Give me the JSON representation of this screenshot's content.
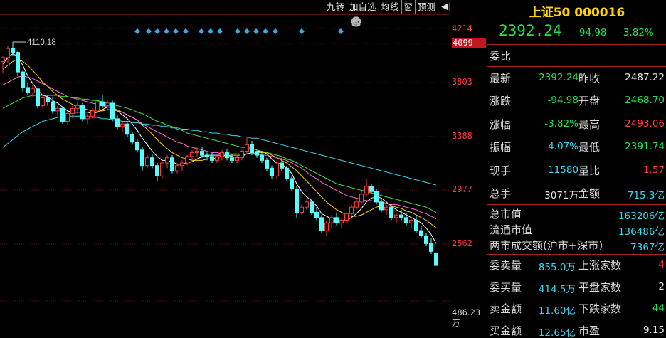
{
  "toolbar": {
    "items": [
      "九转",
      "加自选",
      "均线",
      "窗",
      "预测"
    ],
    "arrow": "◀|"
  },
  "tools": [
    "eye-icon",
    "hand-icon",
    "undo-icon",
    "scissors-icon",
    "lock-icon",
    "zoom-in-icon",
    "zoom-out-icon"
  ],
  "chart_annotation": "4110.18",
  "price_axis": {
    "ticks": [
      "4214",
      "4099",
      "3803",
      "3388",
      "2977",
      "2562"
    ],
    "volume_label": "486.23万"
  },
  "quote": {
    "title": "上证50 000016",
    "price": "2392.24",
    "change": "-94.98",
    "change_pct": "-3.82%"
  },
  "weibi": {
    "label": "委比",
    "value": "–"
  },
  "grid_rows": [
    {
      "l1": "最新",
      "v1": "2392.24",
      "c1": "g",
      "l2": "昨收",
      "v2": "2487.22",
      "c2": "w"
    },
    {
      "l1": "涨跌",
      "v1": "-94.98",
      "c1": "g",
      "l2": "开盘",
      "v2": "2468.70",
      "c2": "g"
    },
    {
      "l1": "涨幅",
      "v1": "-3.82%",
      "c1": "g",
      "l2": "最高",
      "v2": "2493.06",
      "c2": "r"
    },
    {
      "l1": "振幅",
      "v1": "4.07%",
      "c1": "c",
      "l2": "最低",
      "v2": "2391.74",
      "c2": "g"
    },
    {
      "l1": "现手",
      "v1": "11580",
      "c1": "c",
      "l2": "量比",
      "v2": "1.57",
      "c2": "r"
    },
    {
      "l1": "总手",
      "v1": "3071万",
      "c1": "w",
      "l2": "金额",
      "v2": "715.3亿",
      "c2": "c"
    }
  ],
  "market": [
    {
      "label": "总市值",
      "value": "163206亿"
    },
    {
      "label": "流通市值",
      "value": "136486亿"
    },
    {
      "label": "两市成交额(沪市+深市)",
      "value": "7367亿"
    }
  ],
  "stats": [
    {
      "l1": "委卖量",
      "v1": "855.0万",
      "l2": "上涨家数",
      "v2": "4",
      "c2": "r"
    },
    {
      "l1": "委买量",
      "v1": "414.5万",
      "l2": "平盘家数",
      "v2": "2",
      "c2": "w"
    },
    {
      "l1": "卖金额",
      "v1": "11.60亿",
      "l2": "下跌家数",
      "v2": "44",
      "c2": "g"
    },
    {
      "l1": "买金额",
      "v1": "12.65亿",
      "l2": "市盈",
      "v2": "9.15",
      "c2": "w"
    }
  ],
  "chart_data": {
    "type": "candlestick",
    "y_axis_ticks": [
      4214,
      4099,
      3803,
      3388,
      2977,
      2562
    ],
    "peak_label": "4110.18",
    "last_close": 2392.24,
    "ohlc": [
      [
        3960,
        4000,
        3870,
        3990
      ],
      [
        3990,
        4080,
        3950,
        4060
      ],
      [
        4060,
        4110,
        4000,
        4030
      ],
      [
        4030,
        4040,
        3850,
        3880
      ],
      [
        3880,
        3890,
        3730,
        3760
      ],
      [
        3760,
        3800,
        3700,
        3720
      ],
      [
        3720,
        3780,
        3690,
        3750
      ],
      [
        3750,
        3760,
        3600,
        3620
      ],
      [
        3620,
        3700,
        3600,
        3680
      ],
      [
        3680,
        3700,
        3620,
        3650
      ],
      [
        3650,
        3690,
        3560,
        3580
      ],
      [
        3580,
        3620,
        3540,
        3600
      ],
      [
        3600,
        3610,
        3480,
        3500
      ],
      [
        3500,
        3580,
        3470,
        3560
      ],
      [
        3560,
        3620,
        3520,
        3600
      ],
      [
        3600,
        3650,
        3560,
        3620
      ],
      [
        3620,
        3640,
        3500,
        3520
      ],
      [
        3520,
        3560,
        3480,
        3540
      ],
      [
        3540,
        3600,
        3520,
        3580
      ],
      [
        3580,
        3660,
        3560,
        3650
      ],
      [
        3650,
        3700,
        3600,
        3620
      ],
      [
        3620,
        3660,
        3580,
        3640
      ],
      [
        3640,
        3660,
        3500,
        3520
      ],
      [
        3520,
        3550,
        3440,
        3460
      ],
      [
        3460,
        3500,
        3420,
        3480
      ],
      [
        3480,
        3490,
        3380,
        3400
      ],
      [
        3400,
        3420,
        3320,
        3340
      ],
      [
        3340,
        3360,
        3260,
        3280
      ],
      [
        3280,
        3300,
        3120,
        3160
      ],
      [
        3160,
        3240,
        3140,
        3220
      ],
      [
        3220,
        3250,
        3140,
        3160
      ],
      [
        3160,
        3180,
        3040,
        3080
      ],
      [
        3080,
        3200,
        3060,
        3180
      ],
      [
        3180,
        3240,
        3140,
        3220
      ],
      [
        3220,
        3240,
        3100,
        3120
      ],
      [
        3120,
        3180,
        3100,
        3160
      ],
      [
        3160,
        3200,
        3120,
        3180
      ],
      [
        3180,
        3240,
        3160,
        3230
      ],
      [
        3230,
        3280,
        3200,
        3260
      ],
      [
        3260,
        3300,
        3230,
        3270
      ],
      [
        3270,
        3300,
        3220,
        3240
      ],
      [
        3240,
        3260,
        3200,
        3230
      ],
      [
        3230,
        3260,
        3180,
        3200
      ],
      [
        3200,
        3240,
        3180,
        3230
      ],
      [
        3230,
        3280,
        3200,
        3260
      ],
      [
        3260,
        3290,
        3200,
        3220
      ],
      [
        3220,
        3250,
        3180,
        3200
      ],
      [
        3200,
        3240,
        3180,
        3220
      ],
      [
        3220,
        3280,
        3200,
        3270
      ],
      [
        3270,
        3380,
        3250,
        3320
      ],
      [
        3320,
        3350,
        3240,
        3260
      ],
      [
        3260,
        3280,
        3220,
        3240
      ],
      [
        3240,
        3260,
        3180,
        3200
      ],
      [
        3200,
        3220,
        3120,
        3140
      ],
      [
        3140,
        3160,
        3060,
        3080
      ],
      [
        3080,
        3200,
        3060,
        3180
      ],
      [
        3180,
        3220,
        3120,
        3140
      ],
      [
        3140,
        3160,
        3040,
        3060
      ],
      [
        3060,
        3080,
        2960,
        2980
      ],
      [
        2980,
        3000,
        2760,
        2800
      ],
      [
        2800,
        2860,
        2780,
        2840
      ],
      [
        2840,
        2900,
        2820,
        2880
      ],
      [
        2880,
        2900,
        2780,
        2800
      ],
      [
        2800,
        2840,
        2740,
        2760
      ],
      [
        2760,
        2780,
        2640,
        2660
      ],
      [
        2660,
        2740,
        2620,
        2720
      ],
      [
        2720,
        2780,
        2680,
        2760
      ],
      [
        2760,
        2800,
        2700,
        2720
      ],
      [
        2720,
        2760,
        2680,
        2740
      ],
      [
        2740,
        2800,
        2720,
        2790
      ],
      [
        2790,
        2860,
        2760,
        2840
      ],
      [
        2840,
        2900,
        2820,
        2880
      ],
      [
        2880,
        2960,
        2860,
        2940
      ],
      [
        2940,
        3060,
        2920,
        3000
      ],
      [
        3000,
        3020,
        2940,
        2960
      ],
      [
        2960,
        2980,
        2860,
        2880
      ],
      [
        2880,
        2900,
        2800,
        2820
      ],
      [
        2820,
        2860,
        2780,
        2840
      ],
      [
        2840,
        2860,
        2740,
        2760
      ],
      [
        2760,
        2800,
        2720,
        2780
      ],
      [
        2780,
        2820,
        2740,
        2760
      ],
      [
        2760,
        2800,
        2700,
        2720
      ],
      [
        2720,
        2760,
        2680,
        2740
      ],
      [
        2740,
        2780,
        2640,
        2660
      ],
      [
        2660,
        2700,
        2600,
        2620
      ],
      [
        2620,
        2640,
        2540,
        2560
      ],
      [
        2560,
        2600,
        2480,
        2500
      ],
      [
        2487,
        2493,
        2391,
        2392
      ]
    ],
    "ma": [
      {
        "color": "#ffffff",
        "values": [
          3940,
          3990,
          4020,
          4000,
          3930,
          3850,
          3790,
          3740,
          3700,
          3690,
          3660,
          3640,
          3610,
          3580,
          3570,
          3570,
          3570,
          3570,
          3560,
          3570,
          3590,
          3610,
          3610,
          3580,
          3550,
          3520,
          3480,
          3430,
          3370,
          3320,
          3270,
          3230,
          3200,
          3200,
          3190,
          3170,
          3170,
          3180,
          3190,
          3210,
          3230,
          3240,
          3240,
          3240,
          3240,
          3240,
          3230,
          3220,
          3230,
          3250,
          3260,
          3270,
          3270,
          3250,
          3210,
          3180,
          3170,
          3140,
          3100,
          3020,
          2960,
          2920,
          2890,
          2850,
          2790,
          2770,
          2750,
          2740,
          2740,
          2740,
          2760,
          2790,
          2830,
          2880,
          2910,
          2920,
          2910,
          2880,
          2850,
          2820,
          2800,
          2780,
          2760,
          2740,
          2720,
          2680,
          2630,
          2560
        ]
      },
      {
        "color": "#ffd200",
        "values": [
          3900,
          3930,
          3960,
          3980,
          3960,
          3930,
          3890,
          3850,
          3800,
          3770,
          3730,
          3700,
          3670,
          3650,
          3630,
          3610,
          3600,
          3590,
          3580,
          3580,
          3580,
          3590,
          3590,
          3580,
          3570,
          3550,
          3530,
          3510,
          3470,
          3440,
          3400,
          3360,
          3320,
          3290,
          3260,
          3240,
          3220,
          3210,
          3200,
          3200,
          3200,
          3210,
          3210,
          3220,
          3230,
          3240,
          3240,
          3240,
          3240,
          3250,
          3250,
          3260,
          3260,
          3260,
          3240,
          3220,
          3200,
          3180,
          3150,
          3120,
          3080,
          3040,
          3000,
          2960,
          2920,
          2880,
          2850,
          2820,
          2800,
          2780,
          2770,
          2770,
          2780,
          2800,
          2820,
          2840,
          2850,
          2850,
          2850,
          2840,
          2830,
          2810,
          2800,
          2780,
          2760,
          2740,
          2710,
          2680
        ]
      },
      {
        "color": "#ff6ad5",
        "values": [
          3780,
          3800,
          3820,
          3840,
          3850,
          3840,
          3830,
          3810,
          3790,
          3770,
          3750,
          3730,
          3710,
          3690,
          3680,
          3670,
          3660,
          3650,
          3640,
          3630,
          3620,
          3610,
          3600,
          3590,
          3570,
          3550,
          3530,
          3510,
          3480,
          3460,
          3440,
          3420,
          3400,
          3380,
          3360,
          3340,
          3330,
          3310,
          3300,
          3290,
          3280,
          3270,
          3260,
          3260,
          3250,
          3250,
          3250,
          3250,
          3250,
          3250,
          3250,
          3250,
          3240,
          3240,
          3230,
          3220,
          3210,
          3200,
          3180,
          3160,
          3140,
          3110,
          3080,
          3060,
          3030,
          3010,
          2990,
          2970,
          2950,
          2930,
          2920,
          2910,
          2900,
          2890,
          2890,
          2880,
          2880,
          2870,
          2860,
          2860,
          2850,
          2840,
          2830,
          2820,
          2800,
          2790,
          2770,
          2750
        ]
      },
      {
        "color": "#44e04a",
        "values": [
          3600,
          3620,
          3640,
          3660,
          3680,
          3690,
          3700,
          3700,
          3700,
          3700,
          3700,
          3700,
          3690,
          3690,
          3680,
          3680,
          3670,
          3670,
          3660,
          3660,
          3650,
          3640,
          3630,
          3620,
          3610,
          3600,
          3590,
          3570,
          3560,
          3540,
          3520,
          3500,
          3490,
          3470,
          3460,
          3440,
          3430,
          3410,
          3400,
          3390,
          3380,
          3370,
          3360,
          3350,
          3340,
          3330,
          3320,
          3310,
          3300,
          3300,
          3290,
          3280,
          3270,
          3260,
          3250,
          3240,
          3230,
          3210,
          3200,
          3180,
          3160,
          3140,
          3120,
          3100,
          3080,
          3060,
          3040,
          3020,
          3010,
          3000,
          2990,
          2980,
          2970,
          2960,
          2950,
          2940,
          2930,
          2920,
          2910,
          2900,
          2890,
          2880,
          2870,
          2860,
          2850,
          2840,
          2820,
          2800
        ]
      },
      {
        "color": "#3ad8f0",
        "values": [
          3300,
          3330,
          3360,
          3390,
          3420,
          3440,
          3460,
          3480,
          3500,
          3510,
          3520,
          3530,
          3540,
          3540,
          3540,
          3540,
          3540,
          3540,
          3530,
          3530,
          3520,
          3520,
          3510,
          3510,
          3500,
          3500,
          3490,
          3490,
          3480,
          3480,
          3470,
          3470,
          3460,
          3460,
          3450,
          3450,
          3440,
          3440,
          3430,
          3430,
          3420,
          3420,
          3410,
          3410,
          3400,
          3400,
          3390,
          3390,
          3380,
          3380,
          3370,
          3370,
          3360,
          3350,
          3340,
          3330,
          3320,
          3310,
          3300,
          3290,
          3280,
          3270,
          3260,
          3250,
          3240,
          3230,
          3220,
          3210,
          3200,
          3190,
          3180,
          3170,
          3160,
          3150,
          3140,
          3130,
          3120,
          3110,
          3100,
          3090,
          3080,
          3070,
          3060,
          3050,
          3040,
          3030,
          3020,
          3010
        ]
      }
    ]
  }
}
